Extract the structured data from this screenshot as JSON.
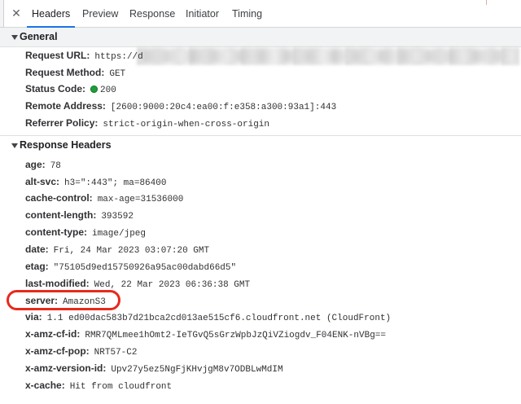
{
  "tabs": [
    {
      "label": "Headers",
      "active": true
    },
    {
      "label": "Preview",
      "active": false
    },
    {
      "label": "Response",
      "active": false
    },
    {
      "label": "Initiator",
      "active": false
    },
    {
      "label": "Timing",
      "active": false
    }
  ],
  "close_icon": "✕",
  "general": {
    "title": "General",
    "rows": [
      {
        "key": "Request URL:",
        "value": "https://d"
      },
      {
        "key": "Request Method:",
        "value": "GET"
      },
      {
        "key": "Status Code:",
        "value": "200"
      },
      {
        "key": "Remote Address:",
        "value": "[2600:9000:20c4:ea00:f:e358:a300:93a1]:443"
      },
      {
        "key": "Referrer Policy:",
        "value": "strict-origin-when-cross-origin"
      }
    ]
  },
  "response_headers": {
    "title": "Response Headers",
    "rows": [
      {
        "key": "age:",
        "value": "78"
      },
      {
        "key": "alt-svc:",
        "value": "h3=\":443\"; ma=86400"
      },
      {
        "key": "cache-control:",
        "value": "max-age=31536000"
      },
      {
        "key": "content-length:",
        "value": "393592"
      },
      {
        "key": "content-type:",
        "value": "image/jpeg"
      },
      {
        "key": "date:",
        "value": "Fri, 24 Mar 2023 03:07:20 GMT"
      },
      {
        "key": "etag:",
        "value": "\"75105d9ed15750926a95ac00dabd66d5\""
      },
      {
        "key": "last-modified:",
        "value": "Wed, 22 Mar 2023 06:36:38 GMT"
      },
      {
        "key": "server:",
        "value": "AmazonS3"
      },
      {
        "key": "via:",
        "value": "1.1 ed00dac583b7d21bca2cd013ae515cf6.cloudfront.net (CloudFront)"
      },
      {
        "key": "x-amz-cf-id:",
        "value": "RMR7QMLmee1hOmt2-IeTGvQ5sGrzWpbJzQiVZiogdv_F04ENK-nVBg=="
      },
      {
        "key": "x-amz-cf-pop:",
        "value": "NRT57-C2"
      },
      {
        "key": "x-amz-version-id:",
        "value": "Upv27y5ez5NgFjKHvjgM8v7ODBLwMdIM"
      },
      {
        "key": "x-cache:",
        "value": "Hit from cloudfront"
      }
    ]
  },
  "colors": {
    "active_tab_underline": "#1a73e8",
    "status_ok": "#1f9d3a",
    "annotation": "#e8291c"
  },
  "icons": {
    "close": "close-icon",
    "expand_general": "triangle-down-icon",
    "expand_response": "triangle-down-icon",
    "status": "status-ok-dot-icon"
  }
}
